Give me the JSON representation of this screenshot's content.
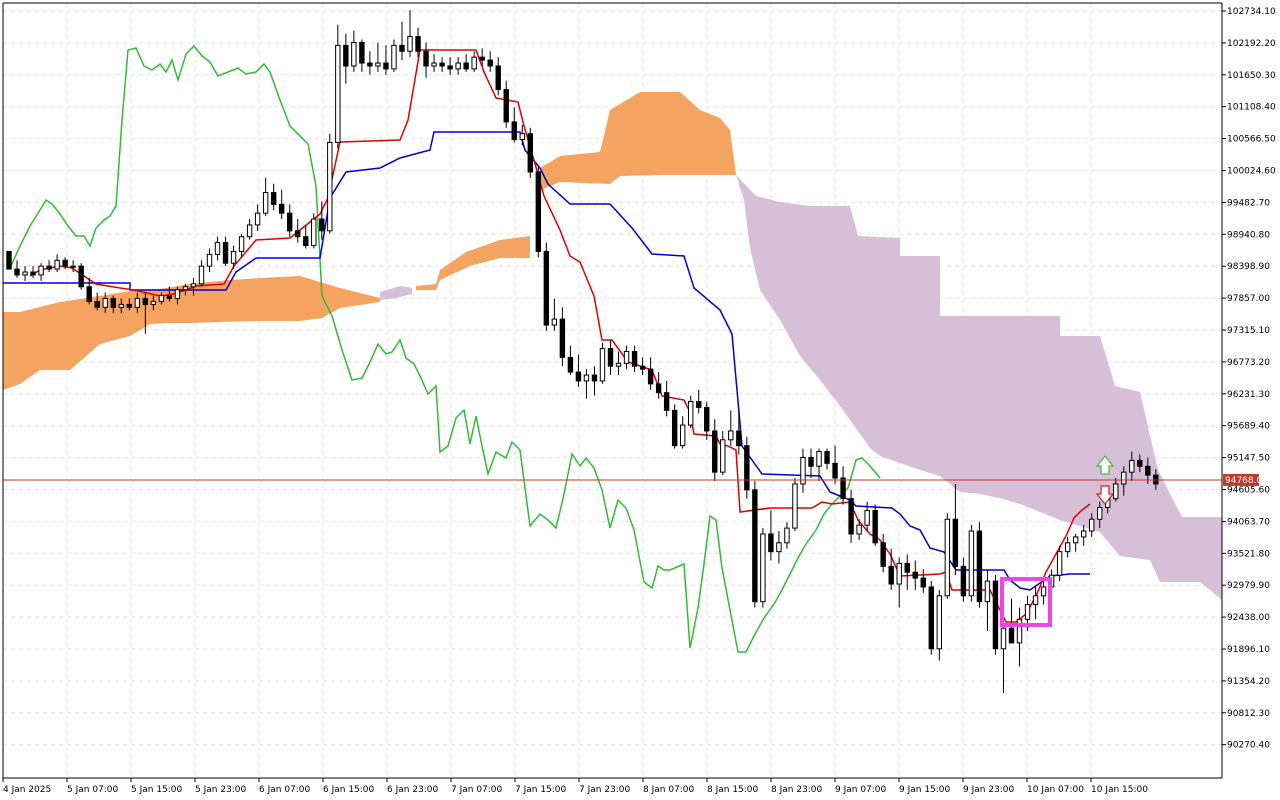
{
  "chart_data": {
    "type": "candlestick",
    "title": "",
    "xlabel": "",
    "ylabel": "",
    "grid": true,
    "ylim": [
      89820,
      102900
    ],
    "y_ticks": [
      102734.1,
      102192.2,
      101650.3,
      101108.4,
      100566.5,
      100024.6,
      99482.7,
      98940.8,
      98398.9,
      97857.0,
      97315.1,
      96773.2,
      96231.3,
      95689.4,
      95147.5,
      94605.6,
      94063.7,
      93521.8,
      92979.9,
      92438.0,
      91896.1,
      91354.2,
      90812.3,
      90270.4
    ],
    "x_ticks": [
      "4 Jan 2025",
      "5 Jan 07:00",
      "5 Jan 15:00",
      "5 Jan 23:00",
      "6 Jan 07:00",
      "6 Jan 15:00",
      "6 Jan 23:00",
      "7 Jan 07:00",
      "7 Jan 15:00",
      "7 Jan 23:00",
      "8 Jan 07:00",
      "8 Jan 15:00",
      "8 Jan 23:00",
      "9 Jan 07:00",
      "9 Jan 15:00",
      "9 Jan 23:00",
      "10 Jan 07:00",
      "10 Jan 15:00"
    ],
    "current_price": 94768.0,
    "current_price_label": "94768.00",
    "colors": {
      "background": "#ffffff",
      "grid": "#e3e3e3",
      "candle": "#000000",
      "tenkan": "#e00000",
      "kijun": "#0000d0",
      "chikou": "#33bb33",
      "cloud_bull": "#f4a460",
      "cloud_bear": "#d8bfd8",
      "price_line": "#c0392b",
      "highlight": "#ee44ee",
      "arrow_up": "#44bb44",
      "arrow_down": "#dd2222"
    },
    "candles": [
      [
        98650,
        98650,
        98350,
        98350
      ],
      [
        98350,
        98500,
        98200,
        98250
      ],
      [
        98250,
        98400,
        98150,
        98300
      ],
      [
        98300,
        98400,
        98200,
        98250
      ],
      [
        98250,
        98450,
        98150,
        98400
      ],
      [
        98400,
        98500,
        98300,
        98350
      ],
      [
        98350,
        98600,
        98300,
        98500
      ],
      [
        98500,
        98550,
        98350,
        98400
      ],
      [
        98400,
        98500,
        98300,
        98400
      ],
      [
        98400,
        98450,
        98000,
        98050
      ],
      [
        98050,
        98200,
        97750,
        97800
      ],
      [
        97800,
        97950,
        97650,
        97700
      ],
      [
        97700,
        97950,
        97600,
        97850
      ],
      [
        97850,
        97900,
        97600,
        97700
      ],
      [
        97700,
        97850,
        97600,
        97750
      ],
      [
        97750,
        97850,
        97650,
        97700
      ],
      [
        97700,
        97950,
        97600,
        97850
      ],
      [
        97850,
        97950,
        97250,
        97750
      ],
      [
        97750,
        97900,
        97650,
        97800
      ],
      [
        97800,
        97950,
        97750,
        97900
      ],
      [
        97900,
        98050,
        97800,
        97850
      ],
      [
        97850,
        98050,
        97750,
        98000
      ],
      [
        98000,
        98100,
        97900,
        98050
      ],
      [
        98050,
        98200,
        97900,
        98100
      ],
      [
        98100,
        98500,
        98050,
        98400
      ],
      [
        98400,
        98700,
        98300,
        98600
      ],
      [
        98600,
        98900,
        98500,
        98800
      ],
      [
        98800,
        98900,
        98400,
        98450
      ],
      [
        98450,
        98750,
        98350,
        98650
      ],
      [
        98650,
        98950,
        98550,
        98900
      ],
      [
        98900,
        99200,
        98850,
        99100
      ],
      [
        99100,
        99450,
        99000,
        99300
      ],
      [
        99300,
        99900,
        99250,
        99650
      ],
      [
        99650,
        99800,
        99350,
        99450
      ],
      [
        99450,
        99700,
        99200,
        99300
      ],
      [
        99300,
        99450,
        98900,
        99000
      ],
      [
        99000,
        99200,
        98800,
        98900
      ],
      [
        98900,
        99100,
        98700,
        98750
      ],
      [
        98750,
        99300,
        98700,
        99200
      ],
      [
        99200,
        99500,
        98850,
        99000
      ],
      [
        99000,
        100650,
        98950,
        100500
      ],
      [
        100500,
        102500,
        100400,
        102150
      ],
      [
        102150,
        102350,
        101500,
        101800
      ],
      [
        101800,
        102400,
        101700,
        102200
      ],
      [
        102200,
        102250,
        101700,
        101850
      ],
      [
        101850,
        102050,
        101650,
        101800
      ],
      [
        101800,
        102200,
        101700,
        101850
      ],
      [
        101850,
        102150,
        101650,
        101750
      ],
      [
        101750,
        102250,
        101700,
        102150
      ],
      [
        102150,
        102550,
        101900,
        102050
      ],
      [
        102050,
        102750,
        101950,
        102300
      ],
      [
        102300,
        102450,
        101950,
        102050
      ],
      [
        102050,
        102200,
        101600,
        101800
      ],
      [
        101800,
        102000,
        101700,
        101850
      ],
      [
        101850,
        101950,
        101700,
        101800
      ],
      [
        101800,
        101950,
        101650,
        101750
      ],
      [
        101750,
        101950,
        101650,
        101850
      ],
      [
        101850,
        102000,
        101700,
        101750
      ],
      [
        101750,
        102050,
        101700,
        101950
      ],
      [
        101950,
        102100,
        101800,
        101900
      ],
      [
        101900,
        102050,
        101700,
        101800
      ],
      [
        101800,
        101950,
        101300,
        101400
      ],
      [
        101400,
        101550,
        100750,
        100850
      ],
      [
        100850,
        101100,
        100500,
        100550
      ],
      [
        100550,
        100800,
        100450,
        100650
      ],
      [
        100650,
        100750,
        99900,
        100000
      ],
      [
        100000,
        100100,
        98550,
        98650
      ],
      [
        98650,
        98800,
        97300,
        97400
      ],
      [
        97400,
        97850,
        97300,
        97500
      ],
      [
        97500,
        97700,
        96700,
        96850
      ],
      [
        96850,
        97050,
        96550,
        96600
      ],
      [
        96600,
        96900,
        96350,
        96450
      ],
      [
        96450,
        96650,
        96150,
        96550
      ],
      [
        96550,
        96700,
        96200,
        96450
      ],
      [
        96450,
        97100,
        96400,
        97000
      ],
      [
        97000,
        97150,
        96550,
        96700
      ],
      [
        96700,
        96950,
        96550,
        96750
      ],
      [
        96750,
        97050,
        96650,
        96950
      ],
      [
        96950,
        97050,
        96600,
        96700
      ],
      [
        96700,
        96850,
        96550,
        96650
      ],
      [
        96650,
        96850,
        96300,
        96400
      ],
      [
        96400,
        96600,
        96150,
        96250
      ],
      [
        96250,
        96450,
        95850,
        95950
      ],
      [
        95950,
        96050,
        95300,
        95350
      ],
      [
        95350,
        95850,
        95300,
        95700
      ],
      [
        95700,
        96200,
        95650,
        96100
      ],
      [
        96100,
        96300,
        95900,
        96000
      ],
      [
        96000,
        96100,
        95450,
        95600
      ],
      [
        95600,
        95800,
        94750,
        94900
      ],
      [
        94900,
        95600,
        94850,
        95450
      ],
      [
        95450,
        95950,
        95350,
        95600
      ],
      [
        95600,
        95950,
        95200,
        95350
      ],
      [
        95350,
        95500,
        94450,
        94600
      ],
      [
        94600,
        94750,
        92600,
        92700
      ],
      [
        92700,
        93950,
        92600,
        93850
      ],
      [
        93850,
        94250,
        93400,
        93550
      ],
      [
        93550,
        93900,
        93350,
        93700
      ],
      [
        93700,
        94050,
        93600,
        93950
      ],
      [
        93950,
        94800,
        93900,
        94700
      ],
      [
        94700,
        95300,
        94550,
        95150
      ],
      [
        95150,
        95300,
        94800,
        95000
      ],
      [
        95000,
        95300,
        94750,
        95250
      ],
      [
        95250,
        95300,
        94950,
        95050
      ],
      [
        95050,
        95350,
        94700,
        94800
      ],
      [
        94800,
        95000,
        94350,
        94450
      ],
      [
        94450,
        94600,
        93700,
        93850
      ],
      [
        93850,
        94100,
        93750,
        94000
      ],
      [
        94000,
        94400,
        93900,
        94250
      ],
      [
        94250,
        94350,
        93650,
        93700
      ],
      [
        93700,
        93850,
        93200,
        93300
      ],
      [
        93300,
        93600,
        92900,
        93000
      ],
      [
        93000,
        93450,
        92600,
        93350
      ],
      [
        93350,
        93500,
        92900,
        93200
      ],
      [
        93200,
        93400,
        92900,
        93100
      ],
      [
        93100,
        93250,
        92850,
        92950
      ],
      [
        92950,
        93050,
        91800,
        91900
      ],
      [
        91900,
        92900,
        91700,
        92800
      ],
      [
        92800,
        94200,
        92750,
        94100
      ],
      [
        94100,
        94700,
        93150,
        93300
      ],
      [
        93300,
        93450,
        92700,
        92800
      ],
      [
        92800,
        94000,
        92700,
        93900
      ],
      [
        93900,
        94050,
        92600,
        92700
      ],
      [
        92700,
        93250,
        92200,
        93050
      ],
      [
        93050,
        93150,
        91800,
        91900
      ],
      [
        91900,
        92300,
        91150,
        92250
      ],
      [
        92250,
        92750,
        92100,
        92000
      ],
      [
        92000,
        92600,
        91600,
        92400
      ],
      [
        92400,
        92800,
        92200,
        92650
      ],
      [
        92650,
        92950,
        92400,
        92800
      ],
      [
        92800,
        93050,
        92650,
        92950
      ],
      [
        92950,
        93250,
        92800,
        93150
      ],
      [
        93150,
        93650,
        93050,
        93550
      ],
      [
        93550,
        93800,
        93450,
        93700
      ],
      [
        93700,
        93850,
        93550,
        93800
      ],
      [
        93800,
        94000,
        93650,
        93900
      ],
      [
        93900,
        94200,
        93800,
        94100
      ],
      [
        94100,
        94400,
        93950,
        94300
      ],
      [
        94300,
        94500,
        94200,
        94450
      ],
      [
        94450,
        94800,
        94400,
        94700
      ],
      [
        94700,
        95000,
        94500,
        94900
      ],
      [
        94900,
        95250,
        94750,
        95100
      ],
      [
        95100,
        95200,
        94900,
        95000
      ],
      [
        95000,
        95150,
        94700,
        94850
      ],
      [
        94850,
        94950,
        94600,
        94700
      ]
    ]
  }
}
